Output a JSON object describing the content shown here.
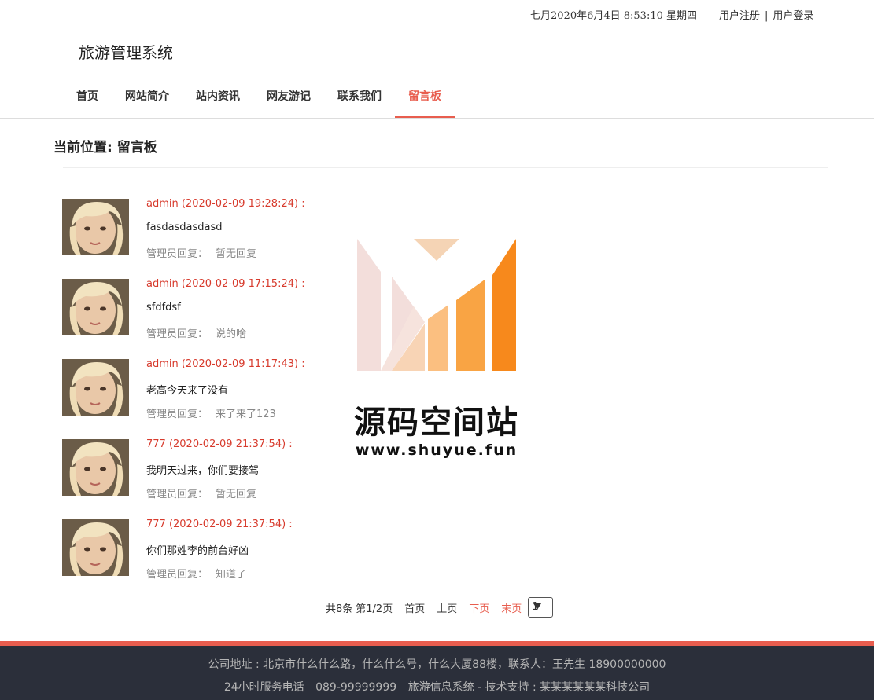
{
  "topbar": {
    "datetime": "七月2020年6月4日 8:53:10 星期四",
    "register": "用户注册",
    "separator": "|",
    "login": "用户登录"
  },
  "site_title": "旅游管理系统",
  "nav": {
    "items": [
      {
        "label": "首页"
      },
      {
        "label": "网站简介"
      },
      {
        "label": "站内资讯"
      },
      {
        "label": "网友游记"
      },
      {
        "label": "联系我们"
      },
      {
        "label": "留言板",
        "active": true
      }
    ]
  },
  "breadcrumb": "当前位置: 留言板",
  "messages": [
    {
      "author": "admin (2020-02-09 19:28:24) :",
      "content": "fasdasdasdasd",
      "reply_label": "管理员回复：",
      "reply": "暂无回复"
    },
    {
      "author": "admin (2020-02-09 17:15:24) :",
      "content": "sfdfdsf",
      "reply_label": "管理员回复：",
      "reply": "说的啥"
    },
    {
      "author": "admin (2020-02-09 11:17:43) :",
      "content": "老高今天来了没有",
      "reply_label": "管理员回复：",
      "reply": "来了来了123"
    },
    {
      "author": "777 (2020-02-09 21:37:54) :",
      "content": "我明天过来，你们要接驾",
      "reply_label": "管理员回复：",
      "reply": "暂无回复"
    },
    {
      "author": "777 (2020-02-09 21:37:54) :",
      "content": "你们那姓李的前台好凶",
      "reply_label": "管理员回复：",
      "reply": "知道了"
    }
  ],
  "watermark": {
    "name": "源码空间站",
    "url": "www.shuyue.fun"
  },
  "pager": {
    "total": "共8条",
    "page_info": "第1/2页",
    "first": "首页",
    "prev": "上页",
    "next": "下页",
    "last": "末页",
    "selected_page": "1"
  },
  "footer": {
    "address": "公司地址 : 北京市什么什么路，什么什么号，什么大厦88楼，联系人：王先生 18900000000",
    "hotline": "24小时服务电话",
    "phone": "089-99999999",
    "support": "旅游信息系统 - 技术支持 : 某某某某某某科技公司"
  },
  "colors": {
    "accent": "#e85d4e",
    "author": "#d73a2c",
    "footer_bg": "#2b2f3a"
  }
}
